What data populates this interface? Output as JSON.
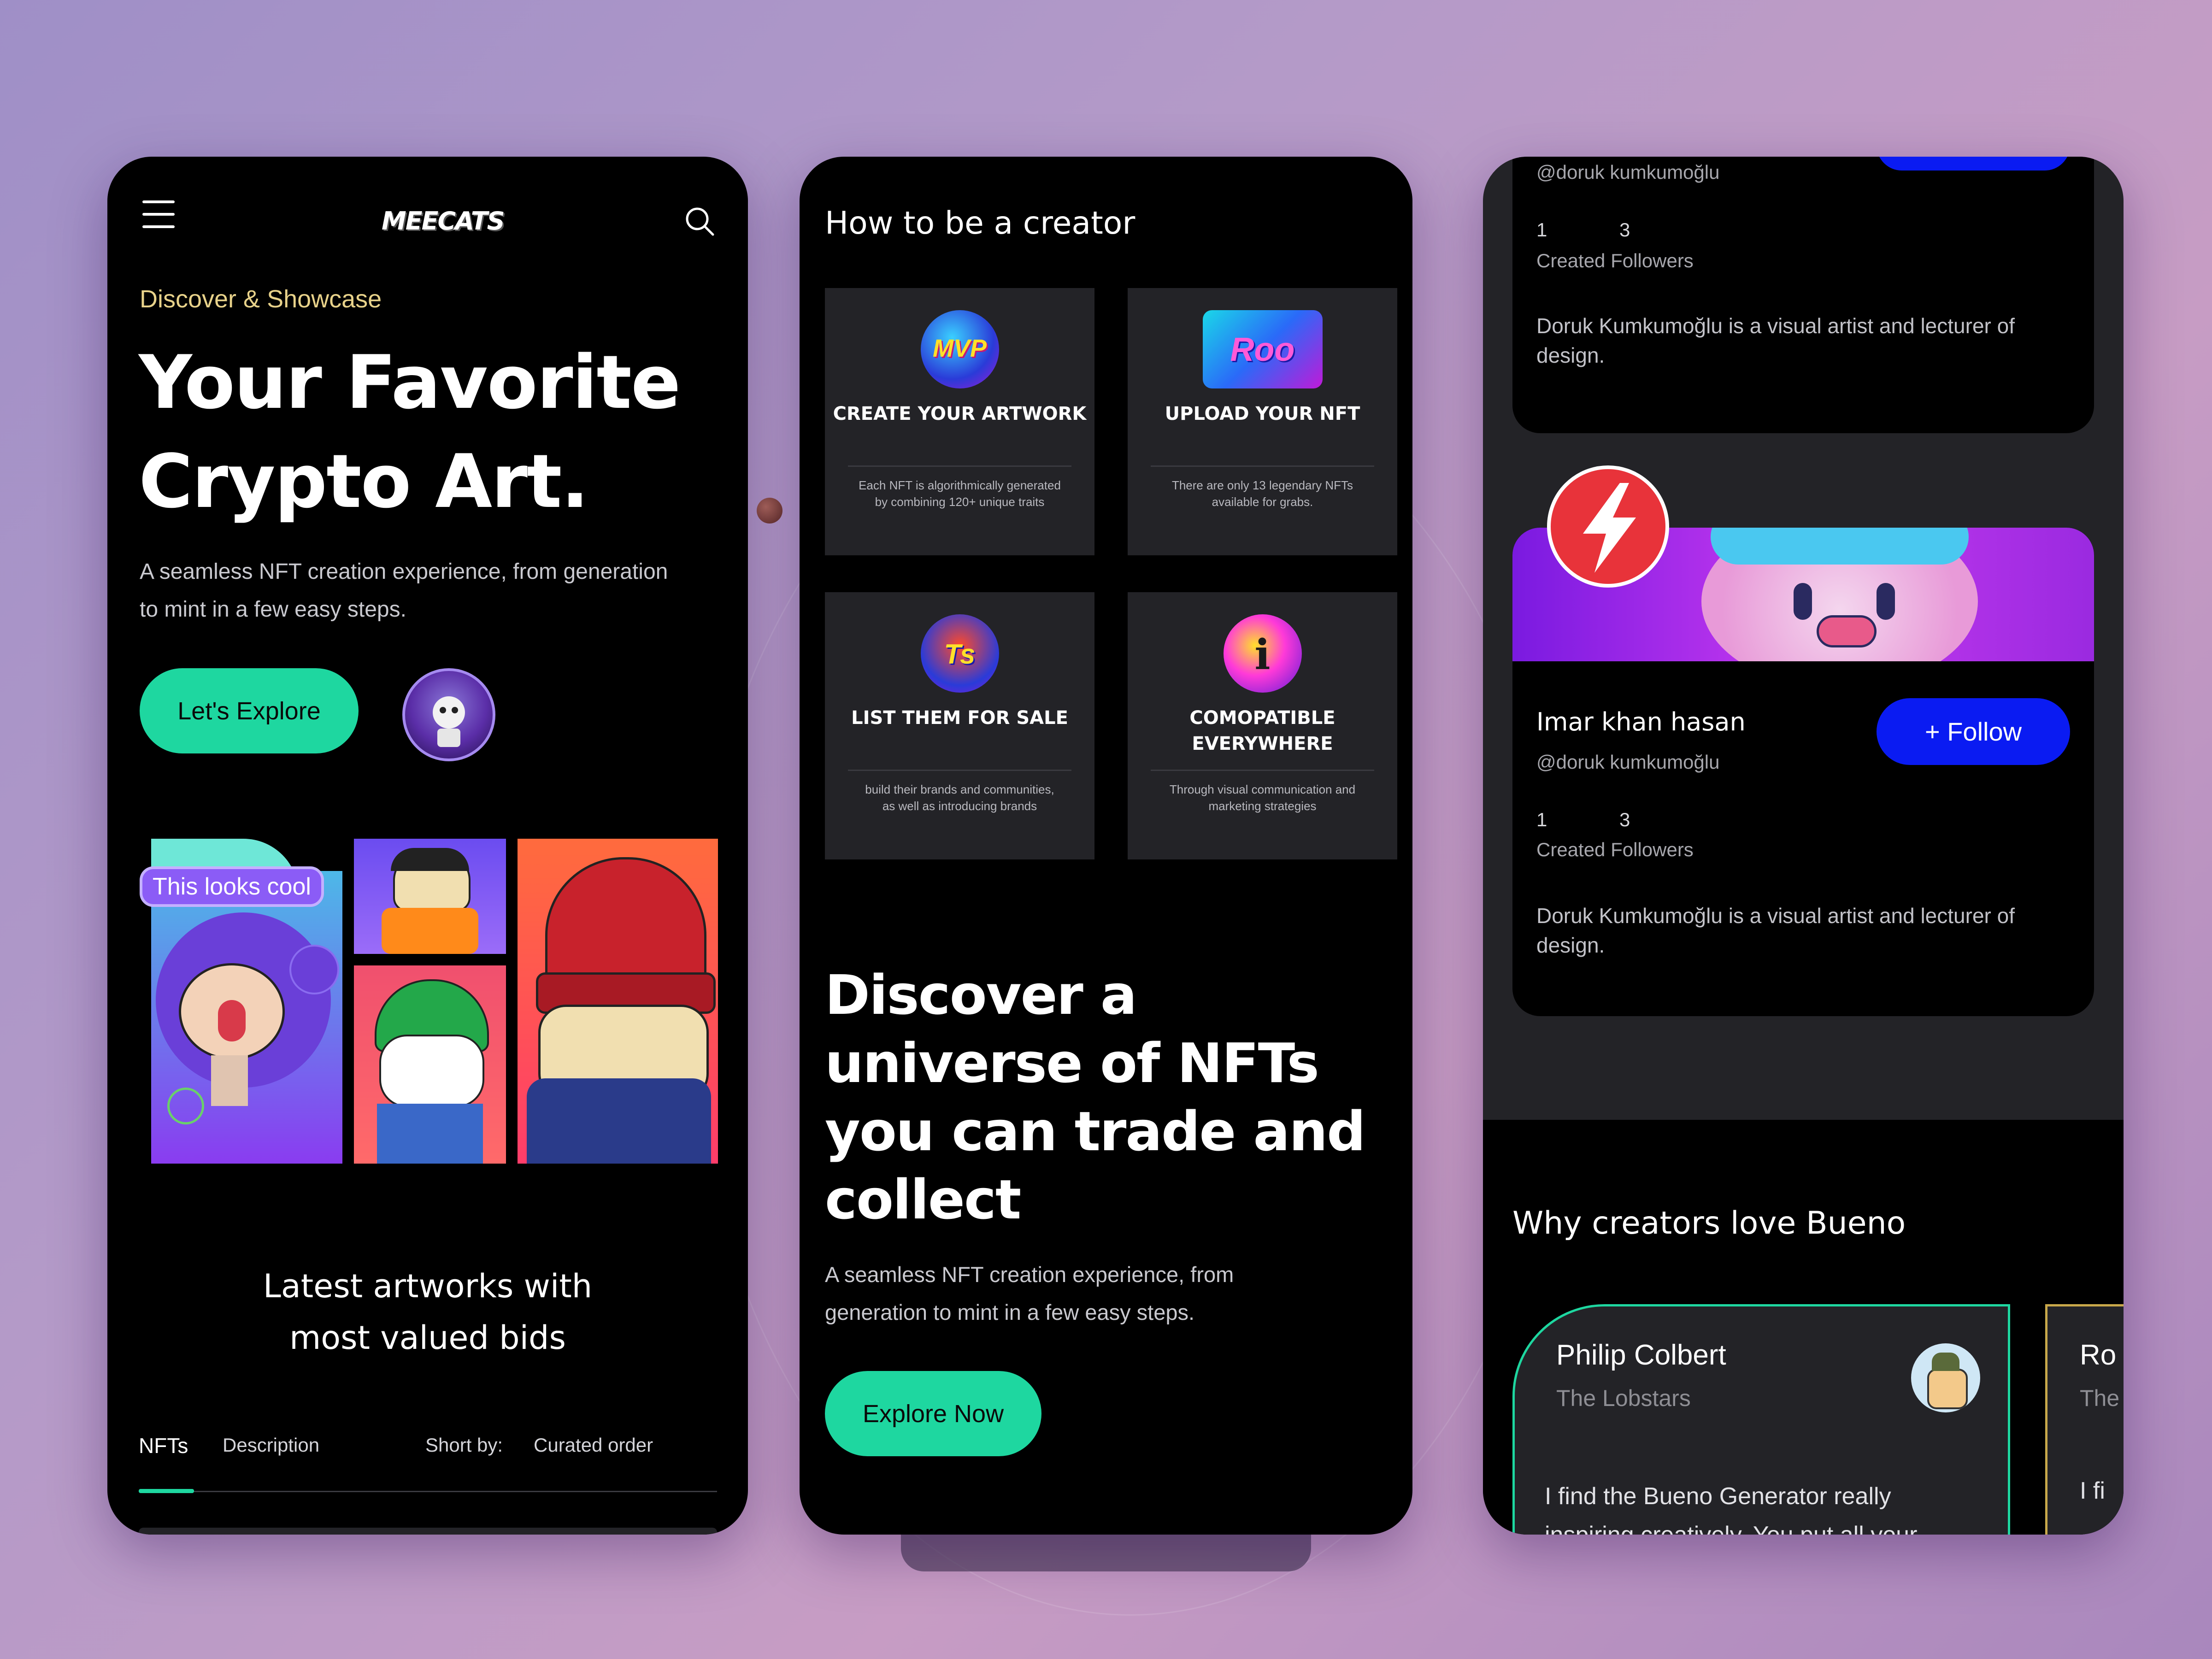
{
  "colors": {
    "accent_green": "#1ED7A0",
    "accent_blue": "#0A1BF2",
    "highlight_gold": "#E8D28A",
    "bubble_purple": "#8B5CF6"
  },
  "screen1": {
    "logo": "MEECATS",
    "menu_icon": "hamburger-menu-icon",
    "search_icon": "search-icon",
    "eyebrow": "Discover & Showcase",
    "headline_line1": "Your Favorite",
    "headline_line2": "Crypto Art.",
    "subtext": "A seamless NFT creation experience, from generation to mint in a few easy steps.",
    "cta_label": "Let's Explore",
    "avatar_icon": "skeleton-astronaut-avatar",
    "speech_bubble": "This looks cool",
    "section_title": "Latest artworks with most valued bids",
    "tabs": [
      {
        "label": "NFTs",
        "active": true
      },
      {
        "label": "Description",
        "active": false
      }
    ],
    "sort_label": "Short by:",
    "sort_value": "Curated order"
  },
  "screen2": {
    "section_title": "How to be a creator",
    "cards": [
      {
        "title": "CREATE YOUR ARTWORK",
        "icon": "mvp-badge-icon",
        "icon_text": "MVP",
        "desc": "Each NFT is algorithmically generated by combining 120+ unique traits"
      },
      {
        "title": "UPLOAD YOUR NFT",
        "icon": "roo-badge-icon",
        "icon_text": "Roo",
        "desc": "There are only 13 legendary NFTs available for grabs."
      },
      {
        "title": "LIST THEM FOR SALE",
        "icon": "ts-badge-icon",
        "icon_text": "Ts",
        "desc": "build their brands and communities, as well as introducing brands"
      },
      {
        "title": "COMOPATIBLE EVERYWHERE",
        "icon": "info-badge-icon",
        "icon_text": "i",
        "desc": "Through visual communication and marketing strategies"
      }
    ],
    "headline": "Discover a universe of NFTs you can trade and collect",
    "subtext": "A seamless NFT creation experience, from generation to mint in a few easy steps.",
    "cta_label": "Explore Now"
  },
  "screen3": {
    "profile_top": {
      "handle": "@doruk kumkumoğlu",
      "created_count": "1",
      "followers_count": "3",
      "stats_label": "Created Followers",
      "bio": "Doruk Kumkumoğlu is a visual artist and lecturer of design."
    },
    "profile_main": {
      "name": "Imar khan hasan",
      "handle": "@doruk kumkumoğlu",
      "follow_label": "+ Follow",
      "created_count": "1",
      "followers_count": "3",
      "stats_label": "Created Followers",
      "bio": "Doruk Kumkumoğlu is a visual artist and lecturer of design.",
      "avatar_icon": "lightning-bolt-icon"
    },
    "section_title": "Why creators love Bueno",
    "testimonials": [
      {
        "name": "Philip Colbert",
        "org": "The Lobstars",
        "quote": "I find the Bueno Generator really inspiring creatively. You put all your"
      },
      {
        "name": "Ro",
        "org": "The",
        "quote": "I fi"
      }
    ]
  }
}
